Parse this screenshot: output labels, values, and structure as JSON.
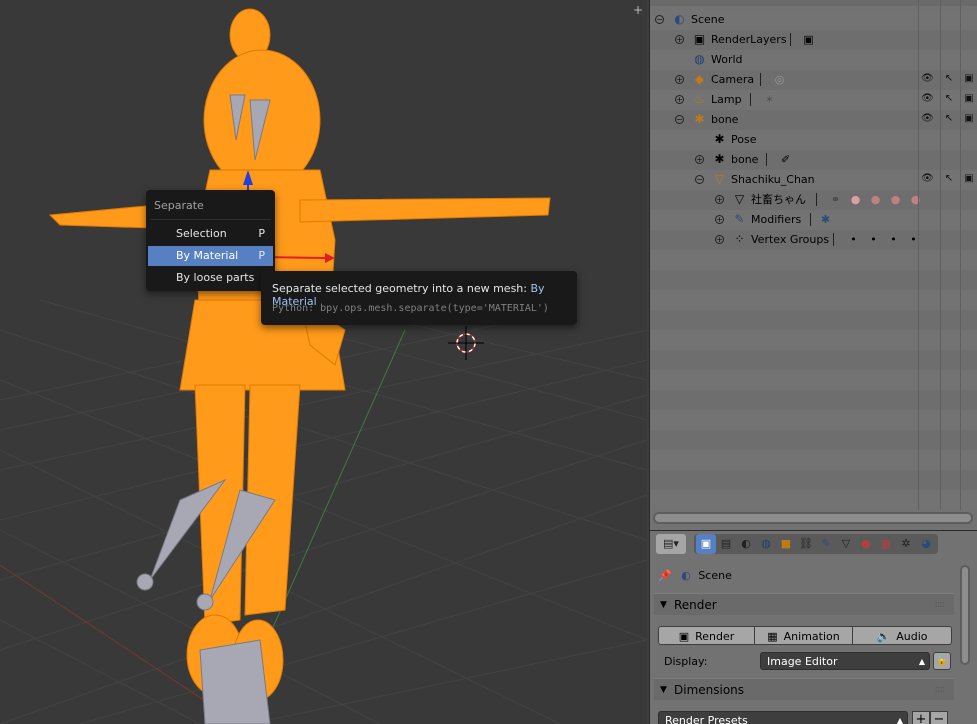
{
  "viewport": {
    "add_label": "+",
    "menu": {
      "title": "Separate",
      "items": [
        {
          "label": "Selection",
          "key": "P"
        },
        {
          "label": "By Material",
          "key": "P"
        },
        {
          "label": "By loose parts",
          "key": ""
        }
      ]
    },
    "tooltip": {
      "text": "Separate selected geometry into a new mesh:",
      "highlight": "By Material",
      "python": "Python: bpy.ops.mesh.separate(type='MATERIAL')"
    }
  },
  "outliner": {
    "rows": [
      {
        "label": "Scene",
        "icon": "scene-icon",
        "glyph": "◐"
      },
      {
        "label": "RenderLayers",
        "icon": "render-layers-icon",
        "glyph": "▣"
      },
      {
        "label": "World",
        "icon": "world-icon",
        "glyph": "◍"
      },
      {
        "label": "Camera",
        "icon": "camera-icon",
        "glyph": "◆"
      },
      {
        "label": "Lamp",
        "icon": "lamp-icon",
        "glyph": "♨"
      },
      {
        "label": "bone",
        "icon": "armature-icon",
        "glyph": "✱"
      },
      {
        "label": "Pose",
        "icon": "pose-icon",
        "glyph": "✱"
      },
      {
        "label": "bone",
        "icon": "armature-data-icon",
        "glyph": "✱"
      },
      {
        "label": "Shachiku_Chan",
        "icon": "mesh-object-icon",
        "glyph": "▽"
      },
      {
        "label": "社畜ちゃん",
        "icon": "mesh-data-icon",
        "glyph": "▽"
      },
      {
        "label": "Modifiers",
        "icon": "wrench-icon",
        "glyph": "✎"
      },
      {
        "label": "Vertex Groups",
        "icon": "vertex-groups-icon",
        "glyph": "⁘"
      }
    ]
  },
  "properties": {
    "context": "Scene",
    "render_panel": "Render",
    "buttons": {
      "render": "Render",
      "animation": "Animation",
      "audio": "Audio"
    },
    "display_label": "Display:",
    "display_value": "Image Editor",
    "dimensions_panel": "Dimensions",
    "render_presets": "Render Presets",
    "add_label": "+",
    "remove_label": "−"
  },
  "colors": {
    "mesh_wire": "#ff9a1a",
    "highlight": "#5680c2",
    "viewport_bg": "#393939",
    "panel_bg": "#727272"
  }
}
